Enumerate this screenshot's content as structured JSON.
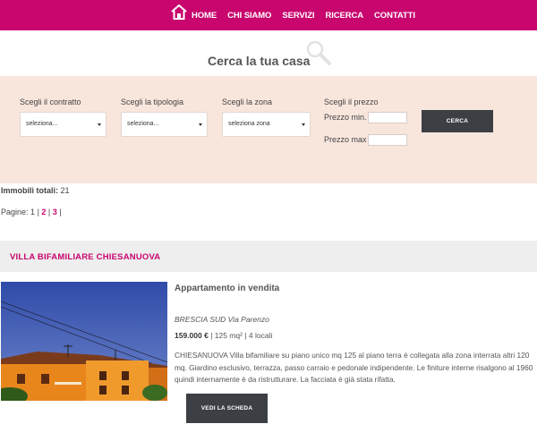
{
  "nav": {
    "home_icon": "house-icon",
    "items": [
      {
        "label": "HOME"
      },
      {
        "label": "CHI SIAMO"
      },
      {
        "label": "SERVIZI"
      },
      {
        "label": "RICERCA"
      },
      {
        "label": "CONTATTI"
      }
    ]
  },
  "search": {
    "title": "Cerca la tua casa",
    "contract": {
      "label": "Scegli il contratto",
      "value": "seleziona..."
    },
    "type": {
      "label": "Scegli la tipologia",
      "value": "seleziona..."
    },
    "zone": {
      "label": "Scegli la zona",
      "value": "seleziona zona"
    },
    "price": {
      "label": "Scegli il prezzo",
      "min_label": "Prezzo min.",
      "max_label": "Prezzo max",
      "min_value": "",
      "max_value": ""
    },
    "button": "CERCA"
  },
  "results": {
    "total_label": "Immobili totali:",
    "total_value": "21",
    "pages_label": "Pagine:",
    "current_page": "1",
    "pages": [
      "2",
      "3"
    ]
  },
  "listing": {
    "title": "VILLA BIFAMILIARE CHIESANUOVA",
    "type": "Appartamento in vendita",
    "location": "BRESCIA SUD Via Parenzo",
    "price": "159.000 €",
    "specs": " | 125 mq² | 4 locali",
    "description": "CHIESANUOVA Villa bifamiliare su piano unico mq 125 al piano terra è collegata alla zona interrata altri 120 mq. Giardino esclusivo, terrazza, passo carraio e pedonale indipendente. Le finiture interne risalgono al 1960 quindi internamente è da ristrutturare. La facciata è già stata rifatta.",
    "button": "VEDI LA SCHEDA"
  },
  "colors": {
    "brand": "#c8066e",
    "panel_bg": "#f8e6dd",
    "button_bg": "#3c3f44"
  }
}
